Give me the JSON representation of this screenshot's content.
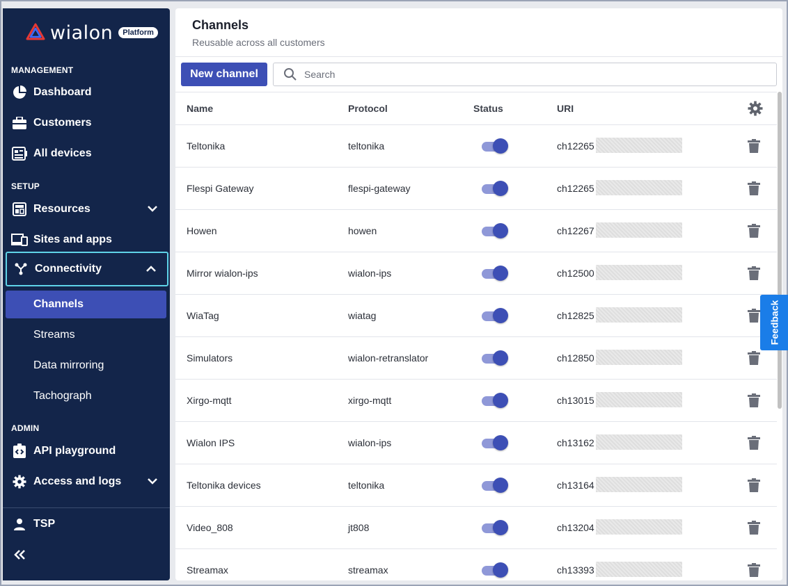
{
  "brand": {
    "name": "wialon",
    "badge": "Platform"
  },
  "sidebar": {
    "sections": {
      "management": "MANAGEMENT",
      "setup": "SETUP",
      "admin": "ADMIN"
    },
    "items": {
      "dashboard": "Dashboard",
      "customers": "Customers",
      "all_devices": "All devices",
      "resources": "Resources",
      "sites_apps": "Sites and apps",
      "connectivity": "Connectivity",
      "api_playground": "API playground",
      "access_logs": "Access and logs",
      "user": "TSP"
    },
    "sub_items": {
      "channels": "Channels",
      "streams": "Streams",
      "data_mirroring": "Data mirroring",
      "tachograph": "Tachograph"
    }
  },
  "page": {
    "title": "Channels",
    "subtitle": "Reusable across all customers"
  },
  "toolbar": {
    "new_label": "New channel",
    "search_placeholder": "Search"
  },
  "table": {
    "columns": {
      "name": "Name",
      "protocol": "Protocol",
      "status": "Status",
      "uri": "URI"
    },
    "rows": [
      {
        "name": "Teltonika",
        "protocol": "teltonika",
        "uri": "ch12265",
        "enabled": true
      },
      {
        "name": "Flespi Gateway",
        "protocol": "flespi-gateway",
        "uri": "ch12265",
        "enabled": true
      },
      {
        "name": "Howen",
        "protocol": "howen",
        "uri": "ch12267",
        "enabled": true
      },
      {
        "name": "Mirror wialon-ips",
        "protocol": "wialon-ips",
        "uri": "ch12500",
        "enabled": true
      },
      {
        "name": "WiaTag",
        "protocol": "wiatag",
        "uri": "ch12825",
        "enabled": true
      },
      {
        "name": "Simulators",
        "protocol": "wialon-retranslator",
        "uri": "ch12850",
        "enabled": true
      },
      {
        "name": "Xirgo-mqtt",
        "protocol": "xirgo-mqtt",
        "uri": "ch13015",
        "enabled": true
      },
      {
        "name": "Wialon IPS",
        "protocol": "wialon-ips",
        "uri": "ch13162",
        "enabled": true
      },
      {
        "name": "Teltonika devices",
        "protocol": "teltonika",
        "uri": "ch13164",
        "enabled": true
      },
      {
        "name": "Video_808",
        "protocol": "jt808",
        "uri": "ch13204",
        "enabled": true
      },
      {
        "name": "Streamax",
        "protocol": "streamax",
        "uri": "ch13393",
        "enabled": true
      }
    ]
  },
  "feedback": {
    "label": "Feedback"
  },
  "colors": {
    "sidebar_bg": "#13254a",
    "accent": "#3d4fb5",
    "feedback": "#1a7de8",
    "expanded_border": "#5fd3e8"
  }
}
